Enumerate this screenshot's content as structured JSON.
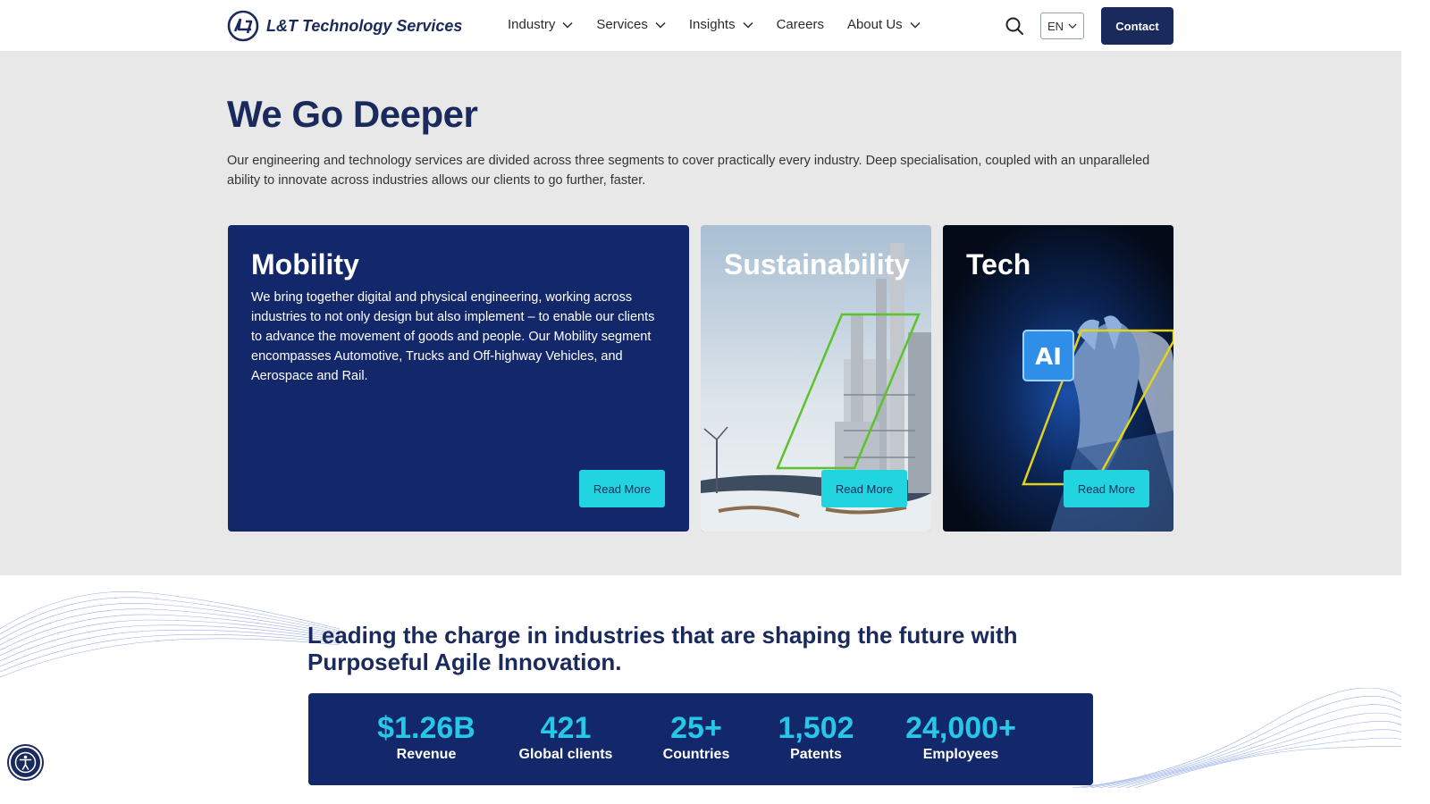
{
  "header": {
    "logo_text": "L&T Technology Services",
    "nav": [
      {
        "label": "Industry",
        "has_dropdown": true
      },
      {
        "label": "Services",
        "has_dropdown": true
      },
      {
        "label": "Insights",
        "has_dropdown": true
      },
      {
        "label": "Careers",
        "has_dropdown": false
      },
      {
        "label": "About Us",
        "has_dropdown": true
      }
    ],
    "language": "EN",
    "contact_label": "Contact"
  },
  "hero": {
    "title": "We Go Deeper",
    "description": "Our engineering and technology services are divided across three segments to cover practically every industry. Deep specialisation, coupled with an unparalleled ability to innovate across industries allows our clients to go further, faster."
  },
  "cards": {
    "mobility": {
      "title": "Mobility",
      "text": "We bring together digital and physical engineering, working across industries to not only design but also implement – to enable our clients to advance the movement of goods and people. Our Mobility segment encompasses Automotive, Trucks and Off-highway Vehicles, and Aerospace and Rail.",
      "button": "Read More"
    },
    "sustainability": {
      "title": "Sustainability",
      "button": "Read More"
    },
    "tech": {
      "title": "Tech",
      "button": "Read More",
      "chip_label": "AI"
    }
  },
  "lower": {
    "title": "Leading the charge in industries that are shaping the future with Purposeful Agile Innovation."
  },
  "stats": [
    {
      "value": "$1.26B",
      "label": "Revenue"
    },
    {
      "value": "421",
      "label": "Global clients"
    },
    {
      "value": "25+",
      "label": "Countries"
    },
    {
      "value": "1,502",
      "label": "Patents"
    },
    {
      "value": "24,000+",
      "label": "Employees"
    }
  ],
  "colors": {
    "navy": "#1a2a5c",
    "card_navy": "#13276b",
    "cyan": "#22d3e0",
    "stat_cyan": "#27c7e8",
    "hero_bg": "#e8e8e9"
  },
  "icons": [
    "lt-logo-icon",
    "chevron-down-icon",
    "search-icon",
    "accessibility-icon"
  ]
}
